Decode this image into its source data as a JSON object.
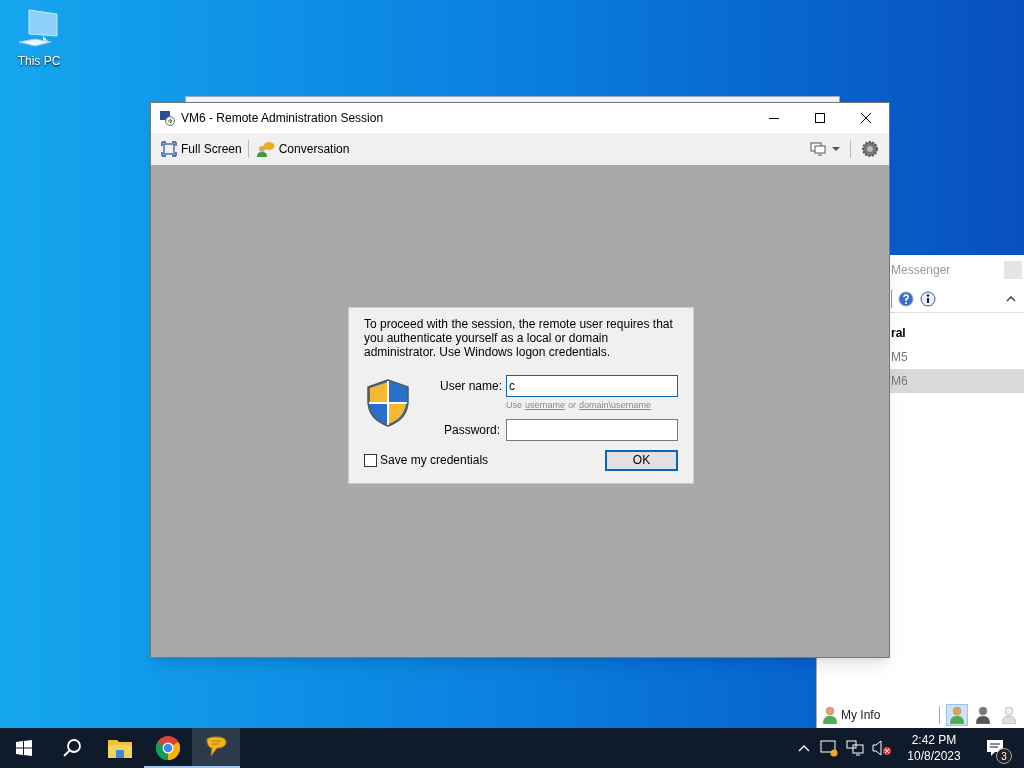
{
  "desktop_icons": [
    {
      "label": "This PC"
    }
  ],
  "main_window": {
    "title": "VM6 - Remote Administration Session",
    "toolbar": [
      {
        "kind": "fullscreen",
        "label": "Full Screen"
      },
      {
        "kind": "conversation",
        "label": "Conversation"
      }
    ],
    "dialog": {
      "message": "To proceed with the session, the remote user requires that you authenticate yourself as a local or domain administrator. Use Windows logon credentials.",
      "username_label": "User name:",
      "username_value": "c",
      "hint": {
        "before": "Use",
        "link_1": "username",
        "middle": "or",
        "link_2": "domain\\username"
      },
      "password_label": "Password:",
      "save_credentials": {
        "label": "Save my credentials",
        "checked": false
      },
      "ok_button": "OK"
    }
  },
  "messenger": {
    "title": "Messenger",
    "items": [
      {
        "kind": "group",
        "label": "ral",
        "selected": false
      },
      {
        "kind": "contact",
        "label": "M5",
        "selected": false
      },
      {
        "kind": "contact",
        "label": "M6",
        "selected": true
      }
    ],
    "my_info": "My Info",
    "statuses": [
      {
        "kind": "online",
        "selected": true
      },
      {
        "kind": "busy",
        "selected": false
      },
      {
        "kind": "offline",
        "selected": false
      }
    ]
  },
  "taskbar": {
    "apps": [
      {
        "kind": "explorer",
        "running": false,
        "selected": false
      },
      {
        "kind": "chrome",
        "running": true,
        "selected": false
      },
      {
        "kind": "messenger",
        "running": true,
        "selected": true
      }
    ],
    "time": "2:42 PM",
    "date": "10/8/2023",
    "notification_count": "3"
  }
}
